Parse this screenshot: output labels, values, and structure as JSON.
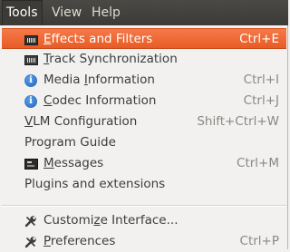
{
  "menubar": {
    "items": [
      {
        "label": "Tools"
      },
      {
        "label": "View"
      },
      {
        "label": "Help"
      }
    ]
  },
  "menu": {
    "items": [
      {
        "label_pre": "",
        "label_ul": "E",
        "label_post": "ffects and Filters",
        "shortcut": "Ctrl+E",
        "icon": "equalizer-board-icon"
      },
      {
        "label_pre": "",
        "label_ul": "T",
        "label_post": "rack Synchronization",
        "shortcut": "",
        "icon": "equalizer-board-icon"
      },
      {
        "label_pre": "Media ",
        "label_ul": "I",
        "label_post": "nformation",
        "shortcut": "Ctrl+I",
        "icon": "info-icon"
      },
      {
        "label_pre": "",
        "label_ul": "C",
        "label_post": "odec Information",
        "shortcut": "Ctrl+J",
        "icon": "info-icon"
      },
      {
        "label_pre": "",
        "label_ul": "V",
        "label_post": "LM Configuration",
        "shortcut": "Shift+Ctrl+W",
        "icon": ""
      },
      {
        "label_pre": "Program Guide",
        "label_ul": "",
        "label_post": "",
        "shortcut": "",
        "icon": ""
      },
      {
        "label_pre": "",
        "label_ul": "M",
        "label_post": "essages",
        "shortcut": "Ctrl+M",
        "icon": "terminal-icon"
      },
      {
        "label_pre": "Plu",
        "label_ul": "g",
        "label_post": "ins and extensions",
        "shortcut": "",
        "icon": ""
      },
      {
        "label_pre": "Customi",
        "label_ul": "z",
        "label_post": "e Interface...",
        "shortcut": "",
        "icon": "wrench-icon"
      },
      {
        "label_pre": "",
        "label_ul": "P",
        "label_post": "references",
        "shortcut": "Ctrl+P",
        "icon": "wrench-icon"
      }
    ]
  },
  "colors": {
    "highlight": "#e85c25",
    "menubar_bg": "#3c3b37",
    "menu_bg": "#f2f1f0"
  }
}
